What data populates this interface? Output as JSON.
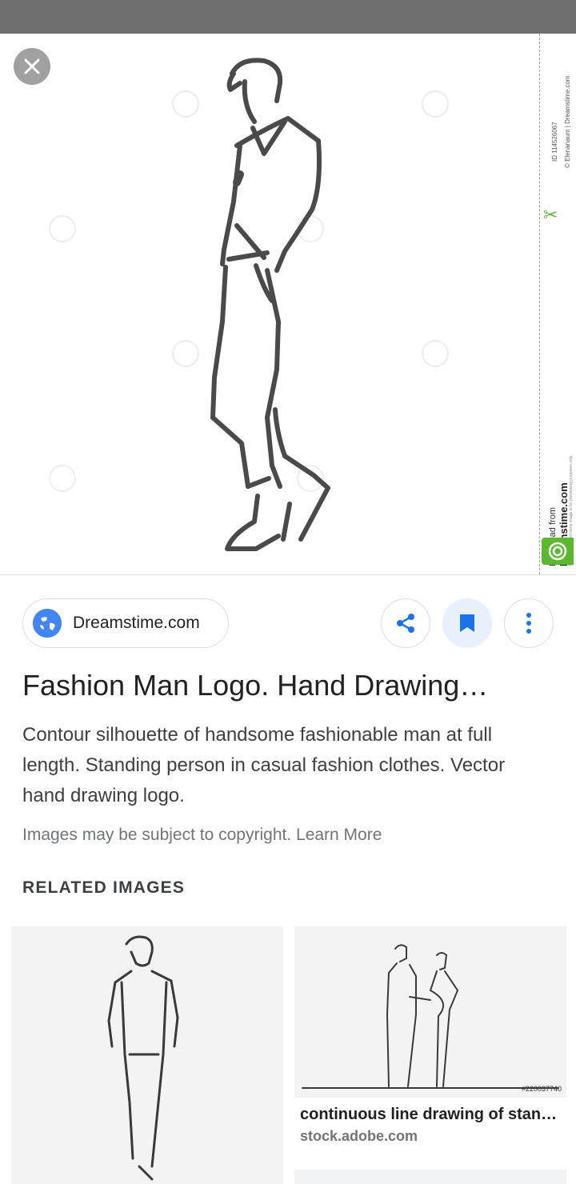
{
  "hero": {
    "strip_id": "ID 114526067",
    "strip_credit": "© Elenanaum | Dreamstime.com",
    "strip_download": "Download from",
    "strip_site": "Dreamstime.com",
    "strip_fineprint": "This watermarked comp image is for previewing purposes only."
  },
  "source": {
    "label": "Dreamstime.com"
  },
  "result": {
    "title": "Fashion Man Logo. Hand Drawing…",
    "description": "Contour silhouette of handsome fashionable man at full length. Standing person in casual fashion clothes. Vector hand drawing logo.",
    "copyright_text": "Images may be subject to copyright.",
    "learn_more": "Learn More"
  },
  "related": {
    "heading": "RELATED IMAGES",
    "items": [
      {
        "caption": "",
        "source": ""
      },
      {
        "caption": "continuous line drawing of stan…",
        "source": "stock.adobe.com",
        "stock_id": "#220037740"
      }
    ]
  },
  "colors": {
    "accent_blue": "#1a73e8",
    "chip_border": "#dadce0",
    "status_bar": "#6e6e6e",
    "dreamstime_green": "#5cb82f"
  },
  "icons": [
    "close-icon",
    "globe-icon",
    "share-icon",
    "bookmark-icon",
    "more-vert-icon"
  ]
}
